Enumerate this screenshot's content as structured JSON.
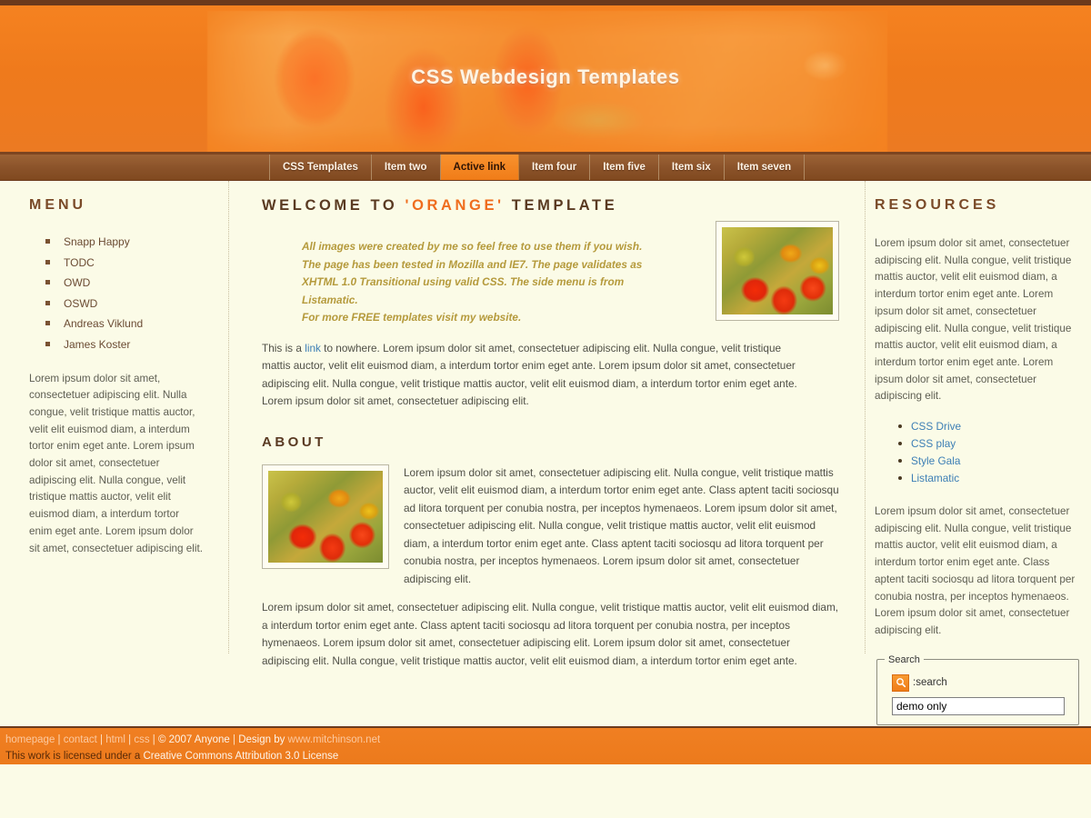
{
  "header": {
    "title": "CSS Webdesign Templates"
  },
  "nav": {
    "items": [
      {
        "label": "CSS Templates",
        "active": false
      },
      {
        "label": "Item two",
        "active": false
      },
      {
        "label": "Active link",
        "active": true
      },
      {
        "label": "Item four",
        "active": false
      },
      {
        "label": "Item five",
        "active": false
      },
      {
        "label": "Item six",
        "active": false
      },
      {
        "label": "Item seven",
        "active": false
      }
    ]
  },
  "sidebar_left": {
    "heading": "MENU",
    "items": [
      {
        "label": "Snapp Happy"
      },
      {
        "label": "TODC"
      },
      {
        "label": "OWD"
      },
      {
        "label": "OSWD"
      },
      {
        "label": "Andreas Viklund"
      },
      {
        "label": "James Koster"
      }
    ],
    "paragraph": "Lorem ipsum dolor sit amet, consectetuer adipiscing elit. Nulla congue, velit tristique mattis auctor, velit elit euismod diam, a interdum tortor enim eget ante. Lorem ipsum dolor sit amet, consectetuer adipiscing elit. Nulla congue, velit tristique mattis auctor, velit elit euismod diam, a interdum tortor enim eget ante. Lorem ipsum dolor sit amet, consectetuer adipiscing elit."
  },
  "main": {
    "welcome_heading_prefix": "WELCOME TO ",
    "welcome_heading_accent": "'ORANGE'",
    "welcome_heading_suffix": " TEMPLATE",
    "intro_lines": [
      "All images were created by me so feel free to use them if you wish.",
      "The page has been tested in Mozilla and IE7. The page validates as",
      "XHTML 1.0 Transitional using valid CSS. The side menu is from",
      "Listamatic.",
      "For more FREE templates visit my website."
    ],
    "paragraph_link_prefix": "This is a ",
    "paragraph_link_text": "link",
    "paragraph_link_suffix": " to nowhere. Lorem ipsum dolor sit amet, consectetuer adipiscing elit. Nulla congue, velit tristique mattis auctor, velit elit euismod diam, a interdum tortor enim eget ante. Lorem ipsum dolor sit amet, consectetuer adipiscing elit. Nulla congue, velit tristique mattis auctor, velit elit euismod diam, a interdum tortor enim eget ante. Lorem ipsum dolor sit amet, consectetuer adipiscing elit.",
    "about_heading": "ABOUT",
    "about_text": "Lorem ipsum dolor sit amet, consectetuer adipiscing elit. Nulla congue, velit tristique mattis auctor, velit elit euismod diam, a interdum tortor enim eget ante. Class aptent taciti sociosqu ad litora torquent per conubia nostra, per inceptos hymenaeos. Lorem ipsum dolor sit amet, consectetuer adipiscing elit. Nulla congue, velit tristique mattis auctor, velit elit euismod diam, a interdum tortor enim eget ante. Class aptent taciti sociosqu ad litora torquent per conubia nostra, per inceptos hymenaeos. Lorem ipsum dolor sit amet, consectetuer adipiscing elit.",
    "about_tail_text": "Lorem ipsum dolor sit amet, consectetuer adipiscing elit. Nulla congue, velit tristique mattis auctor, velit elit euismod diam, a interdum tortor enim eget ante. Class aptent taciti sociosqu ad litora torquent per conubia nostra, per inceptos hymenaeos. Lorem ipsum dolor sit amet, consectetuer adipiscing elit. Lorem ipsum dolor sit amet, consectetuer adipiscing elit. Nulla congue, velit tristique mattis auctor, velit elit euismod diam, a interdum tortor enim eget ante."
  },
  "sidebar_right": {
    "heading": "RESOURCES",
    "paragraph_one": "Lorem ipsum dolor sit amet, consectetuer adipiscing elit. Nulla congue, velit tristique mattis auctor, velit elit euismod diam, a interdum tortor enim eget ante. Lorem ipsum dolor sit amet, consectetuer adipiscing elit. Nulla congue, velit tristique mattis auctor, velit elit euismod diam, a interdum tortor enim eget ante. Lorem ipsum dolor sit amet, consectetuer adipiscing elit.",
    "links": [
      {
        "label": "CSS Drive"
      },
      {
        "label": "CSS play"
      },
      {
        "label": "Style Gala"
      },
      {
        "label": "Listamatic"
      }
    ],
    "paragraph_two": "Lorem ipsum dolor sit amet, consectetuer adipiscing elit. Nulla congue, velit tristique mattis auctor, velit elit euismod diam, a interdum tortor enim eget ante. Class aptent taciti sociosqu ad litora torquent per conubia nostra, per inceptos hymenaeos. Lorem ipsum dolor sit amet, consectetuer adipiscing elit.",
    "search": {
      "legend": "Search",
      "icon": "search-icon",
      "label": ":search",
      "input_value": "demo only"
    }
  },
  "footer": {
    "links": [
      {
        "label": "homepage"
      },
      {
        "label": "contact"
      },
      {
        "label": "html"
      },
      {
        "label": "css"
      }
    ],
    "separator": "|",
    "copyright": "© 2007 Anyone",
    "design_by": "Design by",
    "design_site": "www.mitchinson.net",
    "license_prefix": "This work is licensed under a",
    "license_link": "Creative Commons Attribution 3.0 License"
  },
  "colors": {
    "brand_orange": "#ef7d18",
    "nav_brown": "#8a5229",
    "heading_brown": "#5a3a22",
    "page_bg": "#fbfbe7",
    "link_blue": "#3d7fb5",
    "intro_gold": "#b59a3c"
  }
}
